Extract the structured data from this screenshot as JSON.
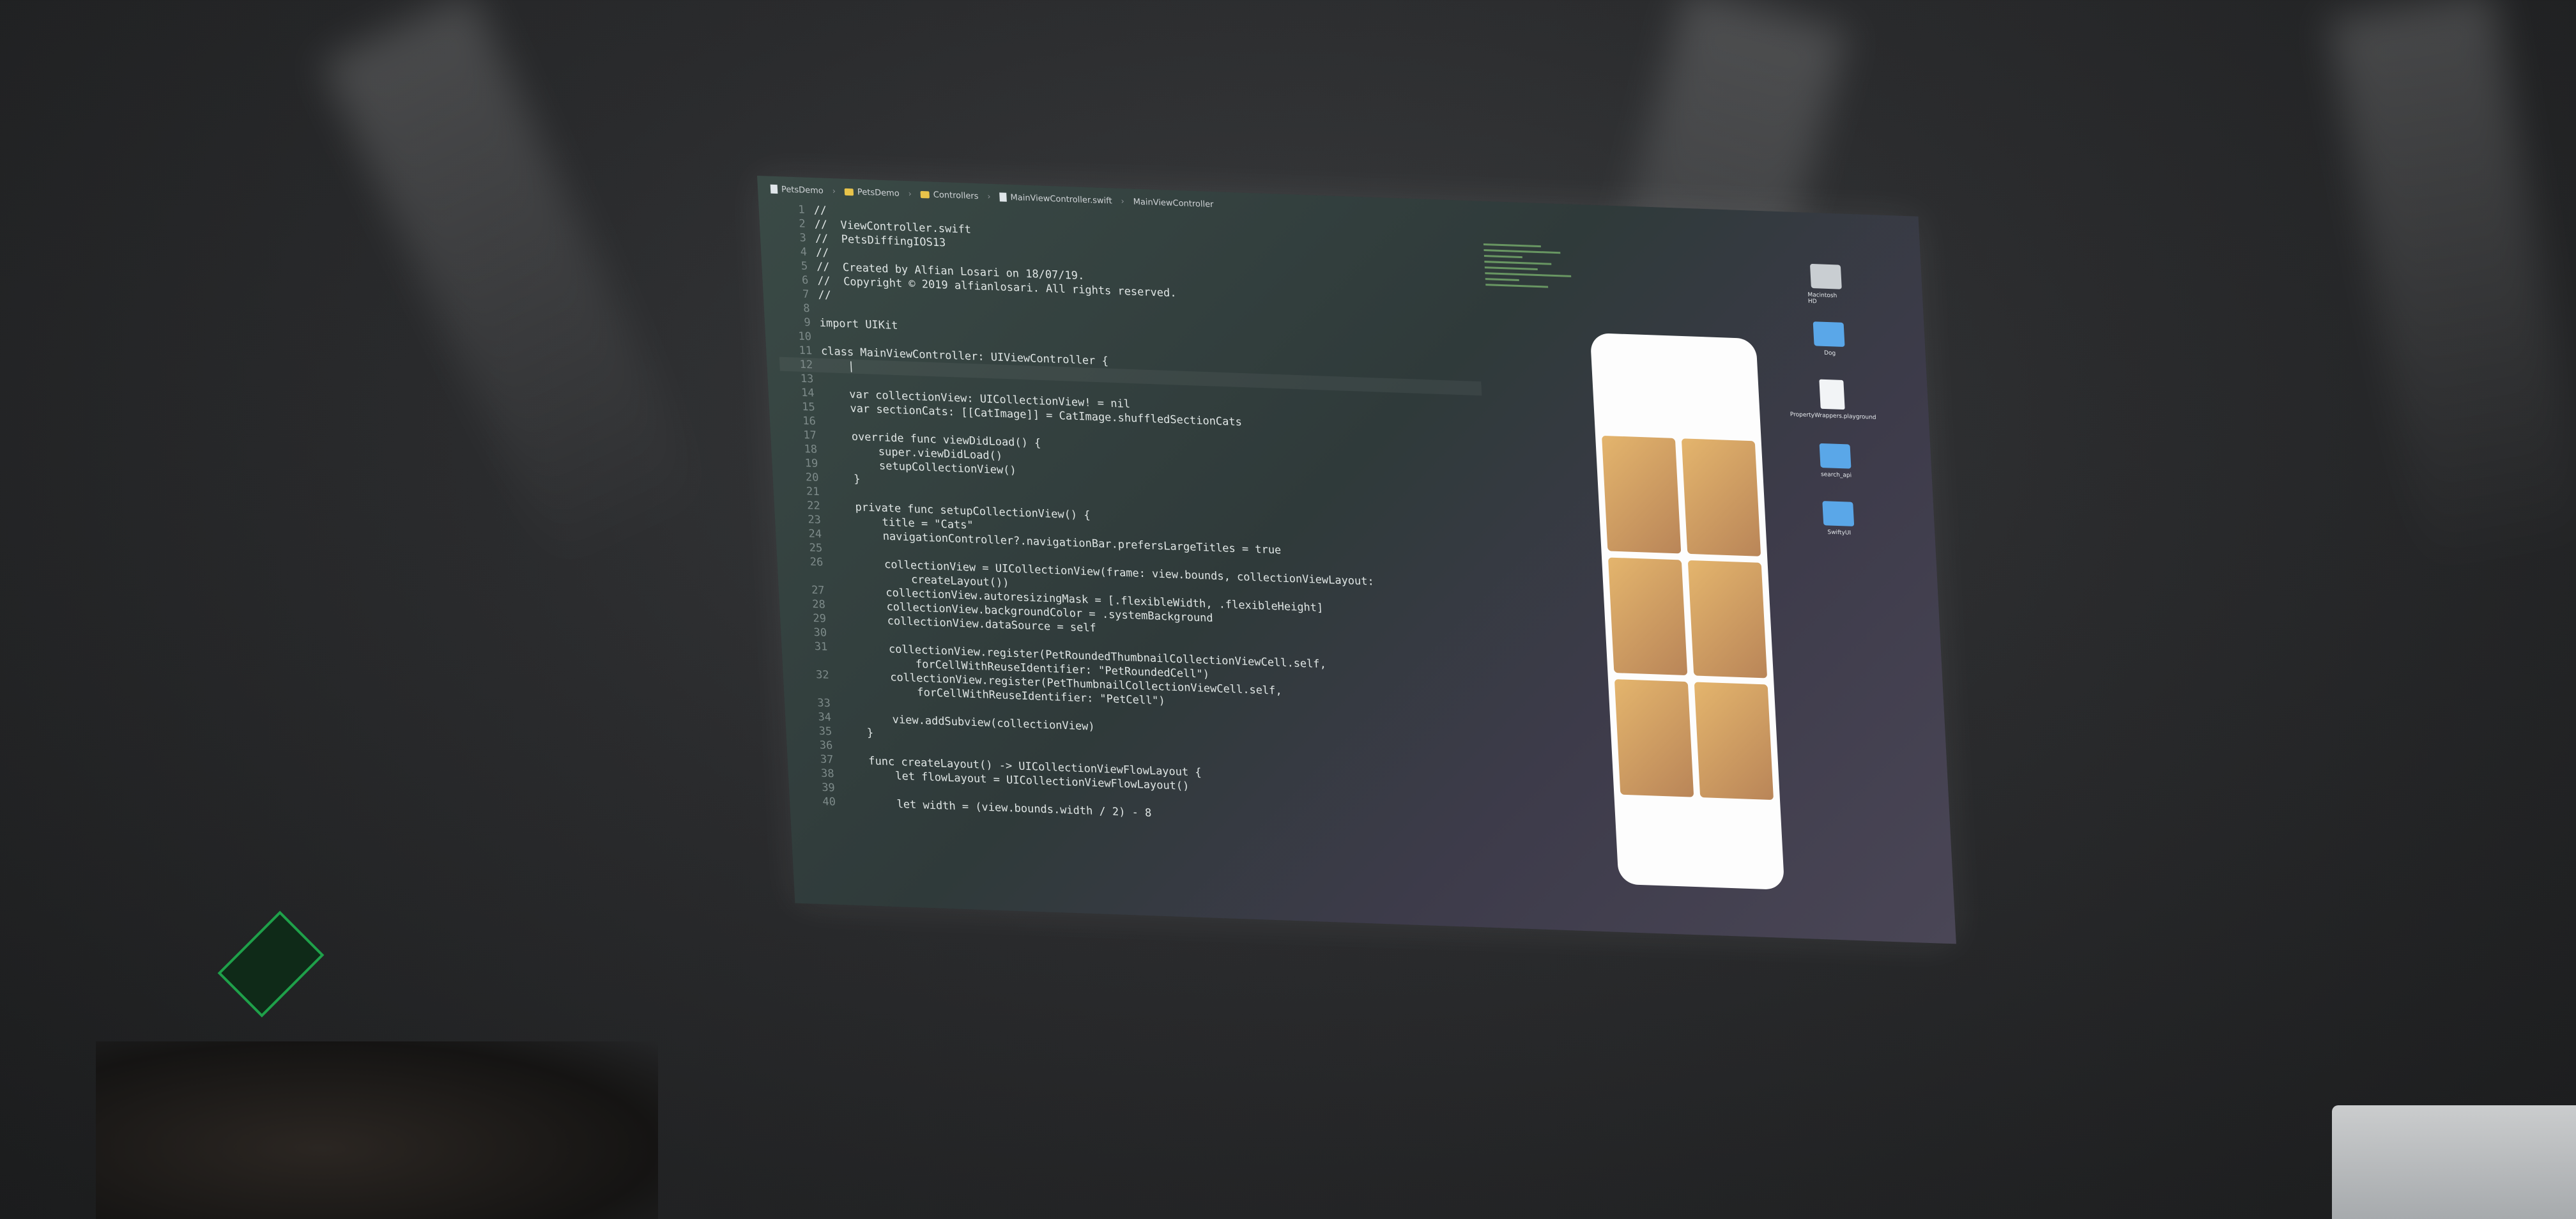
{
  "breadcrumb": [
    "PetsDemo",
    "PetsDemo",
    "Controllers",
    "MainViewController.swift",
    "MainViewController"
  ],
  "code_lines": [
    {
      "n": "1",
      "t": "//"
    },
    {
      "n": "2",
      "t": "//  ViewController.swift"
    },
    {
      "n": "3",
      "t": "//  PetsDiffingIOS13"
    },
    {
      "n": "4",
      "t": "//"
    },
    {
      "n": "5",
      "t": "//  Created by Alfian Losari on 18/07/19."
    },
    {
      "n": "6",
      "t": "//  Copyright © 2019 alfianlosari. All rights reserved."
    },
    {
      "n": "7",
      "t": "//"
    },
    {
      "n": "8",
      "t": ""
    },
    {
      "n": "9",
      "t": "import UIKit"
    },
    {
      "n": "10",
      "t": ""
    },
    {
      "n": "11",
      "t": "class MainViewController: UIViewController {"
    },
    {
      "n": "12",
      "t": "    |"
    },
    {
      "n": "13",
      "t": ""
    },
    {
      "n": "14",
      "t": "    var collectionView: UICollectionView! = nil"
    },
    {
      "n": "15",
      "t": "    var sectionCats: [[CatImage]] = CatImage.shuffledSectionCats"
    },
    {
      "n": "16",
      "t": ""
    },
    {
      "n": "17",
      "t": "    override func viewDidLoad() {"
    },
    {
      "n": "18",
      "t": "        super.viewDidLoad()"
    },
    {
      "n": "19",
      "t": "        setupCollectionView()"
    },
    {
      "n": "20",
      "t": "    }"
    },
    {
      "n": "21",
      "t": ""
    },
    {
      "n": "22",
      "t": "    private func setupCollectionView() {"
    },
    {
      "n": "23",
      "t": "        title = \"Cats\""
    },
    {
      "n": "24",
      "t": "        navigationController?.navigationBar.prefersLargeTitles = true"
    },
    {
      "n": "25",
      "t": ""
    },
    {
      "n": "26",
      "t": "        collectionView = UICollectionView(frame: view.bounds, collectionViewLayout:"
    },
    {
      "n": "",
      "t": "            createLayout())"
    },
    {
      "n": "27",
      "t": "        collectionView.autoresizingMask = [.flexibleWidth, .flexibleHeight]"
    },
    {
      "n": "28",
      "t": "        collectionView.backgroundColor = .systemBackground"
    },
    {
      "n": "29",
      "t": "        collectionView.dataSource = self"
    },
    {
      "n": "30",
      "t": ""
    },
    {
      "n": "31",
      "t": "        collectionView.register(PetRoundedThumbnailCollectionViewCell.self,"
    },
    {
      "n": "",
      "t": "            forCellWithReuseIdentifier: \"PetRoundedCell\")"
    },
    {
      "n": "32",
      "t": "        collectionView.register(PetThumbnailCollectionViewCell.self,"
    },
    {
      "n": "",
      "t": "            forCellWithReuseIdentifier: \"PetCell\")"
    },
    {
      "n": "33",
      "t": ""
    },
    {
      "n": "34",
      "t": "        view.addSubview(collectionView)"
    },
    {
      "n": "35",
      "t": "    }"
    },
    {
      "n": "36",
      "t": ""
    },
    {
      "n": "37",
      "t": "    func createLayout() -> UICollectionViewFlowLayout {"
    },
    {
      "n": "38",
      "t": "        let flowLayout = UICollectionViewFlowLayout()"
    },
    {
      "n": "39",
      "t": ""
    },
    {
      "n": "40",
      "t": "        let width = (view.bounds.width / 2) - 8"
    }
  ],
  "desktop_icons": [
    {
      "label": "Macintosh HD",
      "kind": "disk"
    },
    {
      "label": "Dog",
      "kind": "folder"
    },
    {
      "label": "PropertyWrappers.playground",
      "kind": "doc"
    },
    {
      "label": "search_api",
      "kind": "folder"
    },
    {
      "label": "SwiftyUI",
      "kind": "folder"
    }
  ]
}
